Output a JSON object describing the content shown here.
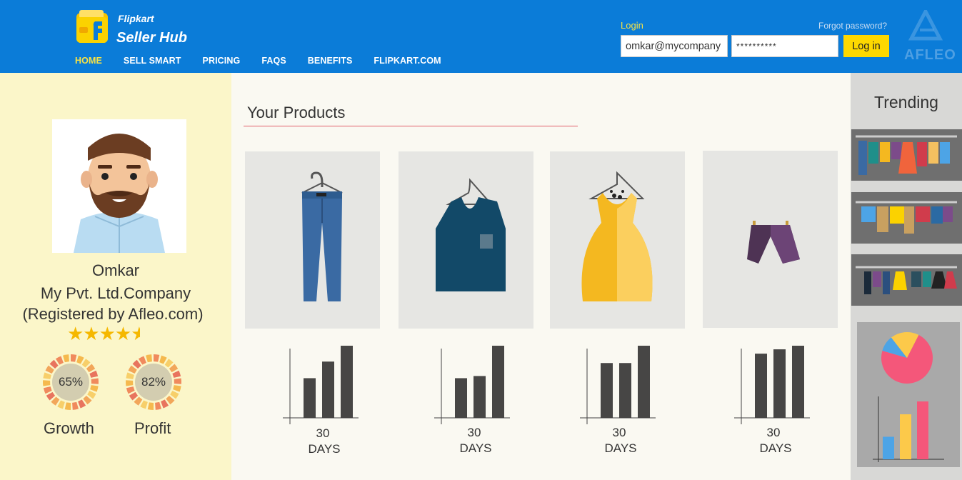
{
  "header": {
    "brand_line1": "Flipkart",
    "brand_line2": "Seller Hub",
    "nav": [
      {
        "label": "HOME",
        "active": true
      },
      {
        "label": "SELL SMART",
        "active": false
      },
      {
        "label": "PRICING",
        "active": false
      },
      {
        "label": "FAQS",
        "active": false
      },
      {
        "label": "BENEFITS",
        "active": false
      },
      {
        "label": "FLIPKART.COM",
        "active": false
      }
    ],
    "login_label": "Login",
    "forgot_password": "Forgot password?",
    "email_value": "omkar@mycompany",
    "password_value": "**********",
    "login_button": "Log in",
    "watermark": "AFLEO"
  },
  "profile": {
    "name": "Omkar",
    "company": "My Pvt. Ltd.Company",
    "registered": "(Registered by Afleo.com)",
    "rating": 4.5,
    "stars": "★★★★",
    "gauges": [
      {
        "label": "Growth",
        "value": "65%"
      },
      {
        "label": "Profit",
        "value": "82%"
      }
    ]
  },
  "main": {
    "title": "Your Products",
    "products": [
      {
        "name": "jeans",
        "days_num": "30",
        "days_lbl": "DAYS",
        "bars": [
          55,
          78,
          100
        ]
      },
      {
        "name": "vest",
        "days_num": "30",
        "days_lbl": "DAYS",
        "bars": [
          55,
          58,
          100
        ]
      },
      {
        "name": "dress",
        "days_num": "30",
        "days_lbl": "DAYS",
        "bars": [
          76,
          76,
          100
        ]
      },
      {
        "name": "shorts",
        "days_num": "30",
        "days_lbl": "DAYS",
        "bars": [
          89,
          95,
          100
        ]
      }
    ]
  },
  "sidebar": {
    "title": "Trending",
    "pie": [
      {
        "value": 72,
        "color": "#f4577a"
      },
      {
        "value": 10,
        "color": "#4da4e6"
      },
      {
        "value": 18,
        "color": "#fcc94a"
      }
    ],
    "bars": [
      {
        "value": 35,
        "color": "#4da4e6"
      },
      {
        "value": 70,
        "color": "#fcc94a"
      },
      {
        "value": 90,
        "color": "#f4577a"
      }
    ]
  },
  "colors": {
    "header": "#0b7cd8",
    "accent": "#f7e245",
    "button": "#fed800",
    "left_panel": "#fbf6c9",
    "bar": "#474645"
  }
}
